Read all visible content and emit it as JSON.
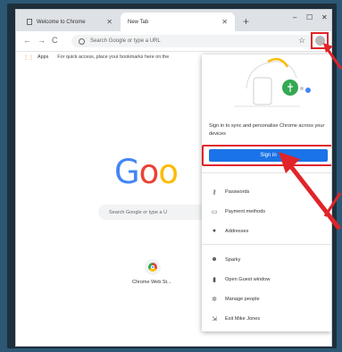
{
  "tabs": [
    {
      "label": "Welcome to Chrome",
      "active": false
    },
    {
      "label": "New Tab",
      "active": true
    }
  ],
  "omnibox": {
    "placeholder": "Search Google or type a URL"
  },
  "bookmarks": {
    "apps_label": "Apps",
    "hint": "For quick access, place your bookmarks here on the"
  },
  "ntp": {
    "logo_letters": [
      "G",
      "o",
      "o"
    ],
    "search_placeholder": "Search Google or type a U",
    "shortcut_label": "Chrome Web St..."
  },
  "profile_menu": {
    "signin_prompt": "Sign in to sync and personalise Chrome across your devices",
    "signin_button": "Sign in",
    "items": [
      {
        "label": "Passwords",
        "icon": "key-icon"
      },
      {
        "label": "Payment methods",
        "icon": "credit-card-icon"
      },
      {
        "label": "Addresses",
        "icon": "location-pin-icon"
      },
      {
        "label": "Sparky",
        "icon": "person-icon"
      },
      {
        "label": "Open Guest window",
        "icon": "guest-icon"
      },
      {
        "label": "Manage people",
        "icon": "gear-icon"
      },
      {
        "label": "Exit Mike Jones",
        "icon": "exit-icon"
      }
    ]
  },
  "colors": {
    "highlight": "#e0242a",
    "signin_button": "#1a73e8"
  }
}
